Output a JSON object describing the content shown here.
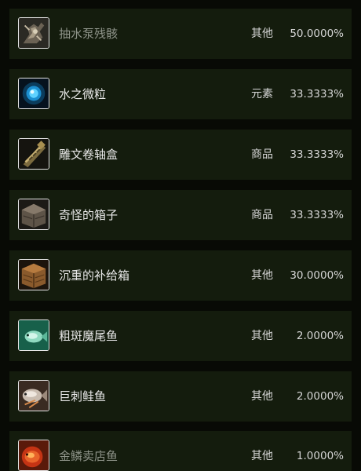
{
  "items": [
    {
      "name": "抽水泵残骸",
      "type": "其他",
      "pct": "50.0000%",
      "icon": "pump-wreck-icon",
      "dim": true
    },
    {
      "name": "水之微粒",
      "type": "元素",
      "pct": "33.3333%",
      "icon": "water-mote-icon",
      "dim": false
    },
    {
      "name": "雕文卷轴盒",
      "type": "商品",
      "pct": "33.3333%",
      "icon": "scroll-case-icon",
      "dim": false
    },
    {
      "name": "奇怪的箱子",
      "type": "商品",
      "pct": "33.3333%",
      "icon": "strange-crate-icon",
      "dim": false
    },
    {
      "name": "沉重的补给箱",
      "type": "其他",
      "pct": "30.0000%",
      "icon": "supply-crate-icon",
      "dim": false
    },
    {
      "name": "粗斑魔尾鱼",
      "type": "其他",
      "pct": "2.0000%",
      "icon": "fish-green-icon",
      "dim": false
    },
    {
      "name": "巨刺鲑鱼",
      "type": "其他",
      "pct": "2.0000%",
      "icon": "salmon-icon",
      "dim": false
    },
    {
      "name": "金鳞卖店鱼",
      "type": "其他",
      "pct": "1.0000%",
      "icon": "goldscale-fish-icon",
      "dim": true
    }
  ],
  "colors": {
    "row_bg": "#141c0d",
    "page_bg": "#080a05",
    "name_text": "#e8e8e8",
    "dim_text": "#8f948a"
  }
}
